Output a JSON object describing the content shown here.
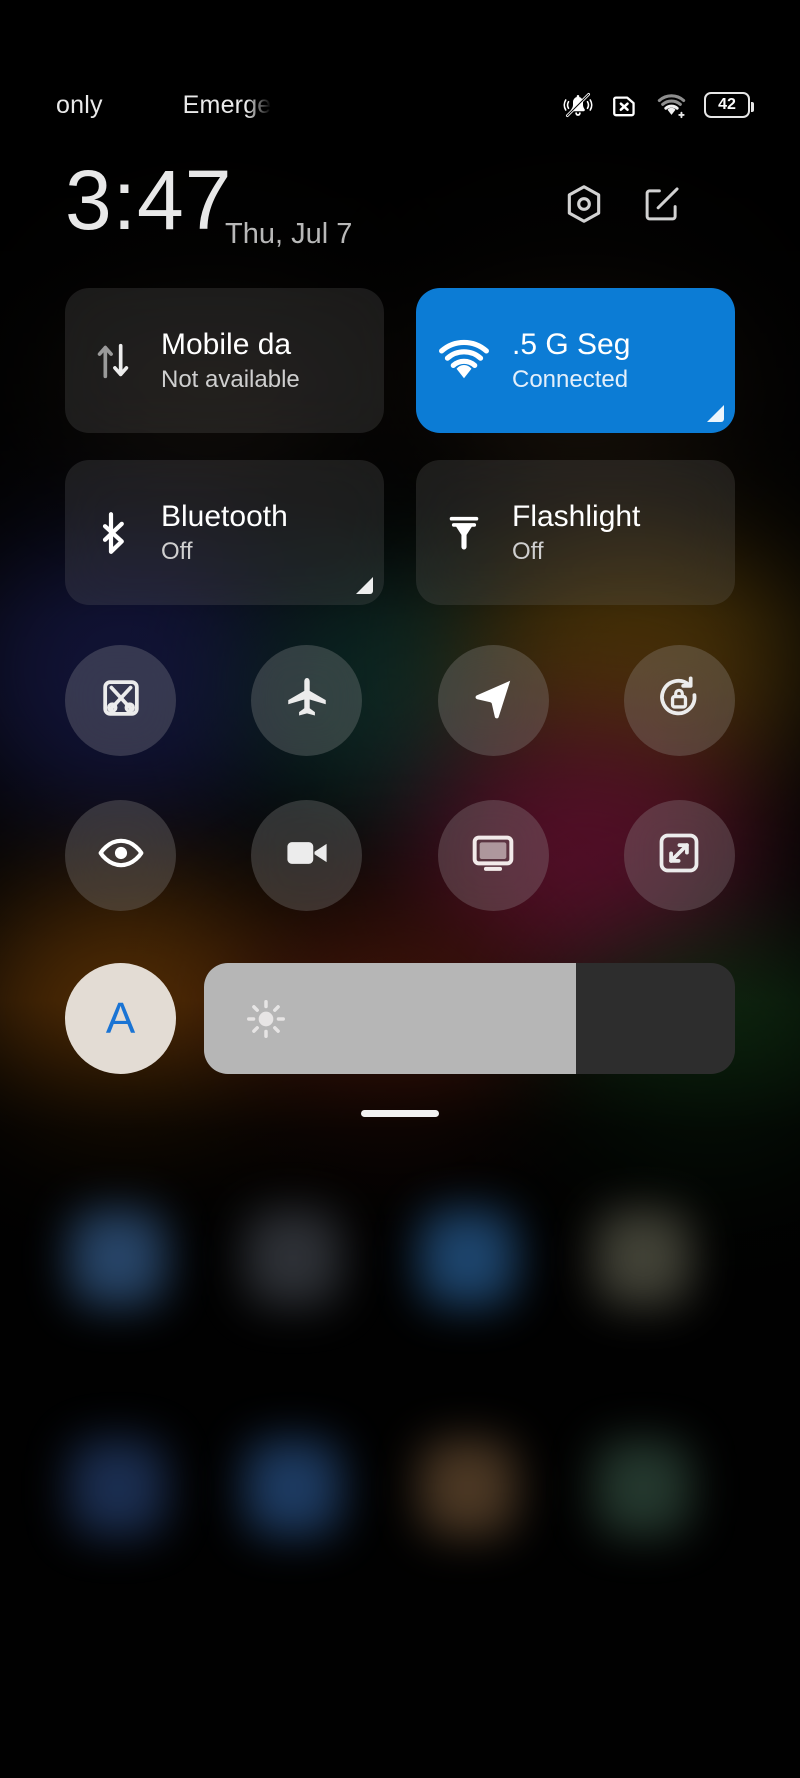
{
  "statusbar": {
    "carrier_left": "only",
    "carrier_right": "Emerge",
    "icons": [
      "bell-mute-icon",
      "sim-missing-icon",
      "wifi-icon",
      "battery-icon"
    ],
    "battery_level": "42"
  },
  "header": {
    "time": "3:47",
    "date": "Thu, Jul 7",
    "settings_icon": "hexagon-settings-icon",
    "edit_icon": "edit-pencil-icon"
  },
  "tiles": [
    {
      "name": "mobile-data",
      "title": "Mobile da",
      "subtitle": "Not available",
      "icon": "data-transfer-icon",
      "state": "off",
      "expandable": false
    },
    {
      "name": "wifi",
      "title": ".5 G       Seg",
      "subtitle": "Connected",
      "icon": "wifi-icon",
      "state": "on",
      "expandable": true
    },
    {
      "name": "bluetooth",
      "title": "Bluetooth",
      "subtitle": "Off",
      "icon": "bluetooth-icon",
      "state": "off",
      "expandable": true
    },
    {
      "name": "flashlight",
      "title": "Flashlight",
      "subtitle": "Off",
      "icon": "flashlight-icon",
      "state": "off",
      "expandable": false
    }
  ],
  "toggles_row1": [
    {
      "name": "screenshot",
      "icon": "screenshot-scissors-icon"
    },
    {
      "name": "airplane-mode",
      "icon": "airplane-icon"
    },
    {
      "name": "location",
      "icon": "location-arrow-icon"
    },
    {
      "name": "rotation-lock",
      "icon": "rotation-lock-icon"
    }
  ],
  "toggles_row2": [
    {
      "name": "reading-mode",
      "icon": "eye-icon"
    },
    {
      "name": "screen-recorder",
      "icon": "video-camera-icon"
    },
    {
      "name": "cast",
      "icon": "monitor-cast-icon"
    },
    {
      "name": "fullscreen",
      "icon": "expand-arrows-icon"
    }
  ],
  "brightness": {
    "auto_label": "A",
    "auto_active_color": "#1a74d4",
    "slider_icon": "sun-brightness-icon",
    "level_percent": 70
  },
  "colors": {
    "accent_on": "#0c7cd5",
    "tile_off": "rgba(150,150,150,0.17)",
    "slider_track": "#2d2d2d",
    "slider_fill": "#b6b6b6",
    "auto_button": "#e3dcd4"
  },
  "home_indicator": "home-indicator"
}
